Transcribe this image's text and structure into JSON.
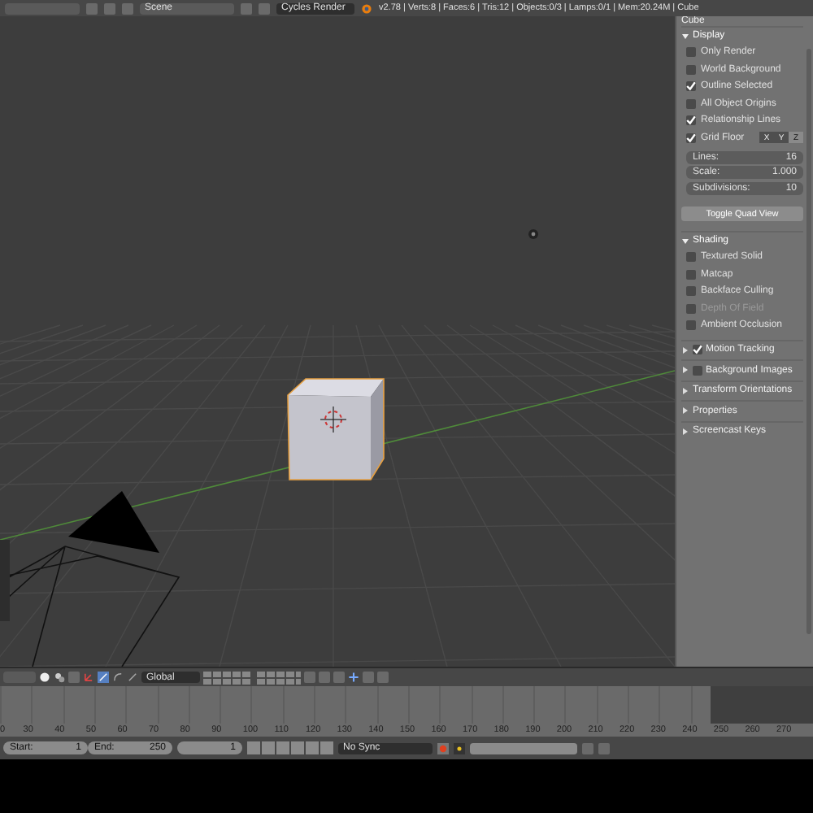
{
  "top_bar": {
    "scene": "Scene",
    "render_engine": "Cycles Render",
    "stats": "v2.78 | Verts:8 | Faces:6 | Tris:12 | Objects:0/3 | Lamps:0/1 | Mem:20.24M | Cube"
  },
  "properties": {
    "object_name": "Cube",
    "display": {
      "title": "Display",
      "expanded": true,
      "options": [
        {
          "label": "Only Render",
          "checked": false
        },
        {
          "label": "World Background",
          "checked": false
        },
        {
          "label": "Outline Selected",
          "checked": true
        },
        {
          "label": "All Object Origins",
          "checked": false
        },
        {
          "label": "Relationship Lines",
          "checked": true
        }
      ],
      "grid_floor": {
        "label": "Grid Floor",
        "checked": true,
        "axes": [
          {
            "label": "X",
            "selected": false
          },
          {
            "label": "Y",
            "selected": false
          },
          {
            "label": "Z",
            "selected": true
          }
        ]
      },
      "fields": [
        {
          "label": "Lines:",
          "value": "16"
        },
        {
          "label": "Scale:",
          "value": "1.000"
        },
        {
          "label": "Subdivisions:",
          "value": "10"
        }
      ],
      "button": "Toggle Quad View"
    },
    "shading": {
      "title": "Shading",
      "expanded": true,
      "options": [
        {
          "label": "Textured Solid",
          "checked": false,
          "disabled": false
        },
        {
          "label": "Matcap",
          "checked": false,
          "disabled": false
        },
        {
          "label": "Backface Culling",
          "checked": false,
          "disabled": false
        },
        {
          "label": "Depth Of Field",
          "checked": false,
          "disabled": true
        },
        {
          "label": "Ambient Occlusion",
          "checked": false,
          "disabled": false
        }
      ]
    },
    "panels": [
      {
        "title": "Motion Tracking",
        "expanded": false,
        "kind": "checkbox",
        "checked": true
      },
      {
        "title": "Background Images",
        "expanded": false,
        "kind": "checkbox",
        "checked": false
      },
      {
        "title": "Transform Orientations",
        "expanded": false,
        "kind": "plain"
      },
      {
        "title": "Properties",
        "expanded": false,
        "kind": "plain"
      },
      {
        "title": "Screencast Keys",
        "expanded": false,
        "kind": "plain"
      }
    ]
  },
  "toolbar": {
    "orientation": "Global"
  },
  "timeline": {
    "ticks": [
      "0",
      "30",
      "40",
      "50",
      "60",
      "70",
      "80",
      "90",
      "100",
      "110",
      "120",
      "130",
      "140",
      "150",
      "160",
      "170",
      "180",
      "190",
      "200",
      "210",
      "220",
      "230",
      "240",
      "250",
      "260",
      "270"
    ]
  },
  "playback": {
    "start_label": "Start:",
    "start": "1",
    "end_label": "End:",
    "end": "250",
    "current": "1",
    "sync": "No Sync"
  }
}
